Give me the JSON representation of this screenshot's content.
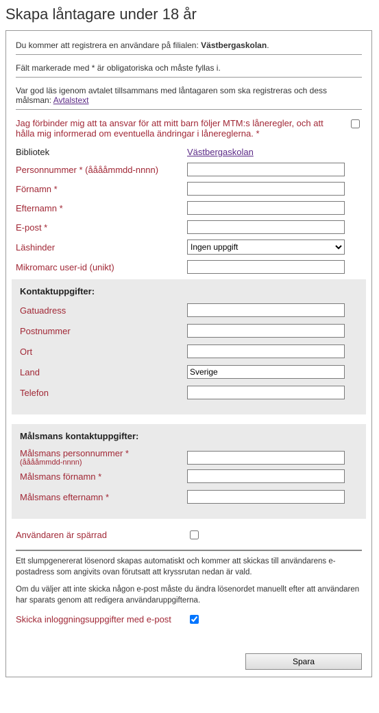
{
  "page_title": "Skapa låntagare under 18 år",
  "intro": {
    "prefix": "Du kommer att registrera en användare på filialen: ",
    "branch": "Västbergaskolan",
    "suffix": "."
  },
  "required_note": "Fält markerade med * är obligatoriska och måste fyllas i.",
  "agreement_intro": {
    "text": "Var god läs igenom avtalet tillsammans med låntagaren som ska registreras och dess målsman: ",
    "link": "Avtalstext"
  },
  "agreement_consent": "Jag förbinder mig att ta ansvar för att mitt barn följer MTM:s låneregler, och att hålla mig informerad om eventuella ändringar i lånereglerna. *",
  "fields": {
    "library_label": "Bibliotek",
    "library_value": "Västbergaskolan",
    "ssn_label": "Personnummer * (ååååmmdd-nnnn)",
    "firstname_label": "Förnamn *",
    "lastname_label": "Efternamn *",
    "email_label": "E-post *",
    "reading_label": "Läshinder",
    "reading_value": "Ingen uppgift",
    "mikromarc_label": "Mikromarc user-id (unikt)"
  },
  "contact": {
    "title": "Kontaktuppgifter:",
    "street_label": "Gatuadress",
    "zip_label": "Postnummer",
    "city_label": "Ort",
    "country_label": "Land",
    "country_value": "Sverige",
    "phone_label": "Telefon"
  },
  "guardian": {
    "title": "Målsmans kontaktuppgifter:",
    "ssn_label": "Målsmans personnummer *",
    "ssn_hint": "(ååååmmdd-nnnn)",
    "firstname_label": "Målsmans förnamn *",
    "lastname_label": "Målsmans efternamn *"
  },
  "blocked_label": "Användaren är spärrad",
  "footer": {
    "p1": "Ett slumpgenererat lösenord skapas automatiskt och kommer att skickas till användarens e-postadress som angivits ovan förutsatt att kryssrutan nedan är vald.",
    "p2": "Om du väljer att inte skicka någon e-post måste du ändra lösenordet manuellt efter att användaren har sparats genom att redigera användaruppgifterna."
  },
  "send_label": "Skicka inloggningsuppgifter med e-post",
  "save_label": "Spara"
}
